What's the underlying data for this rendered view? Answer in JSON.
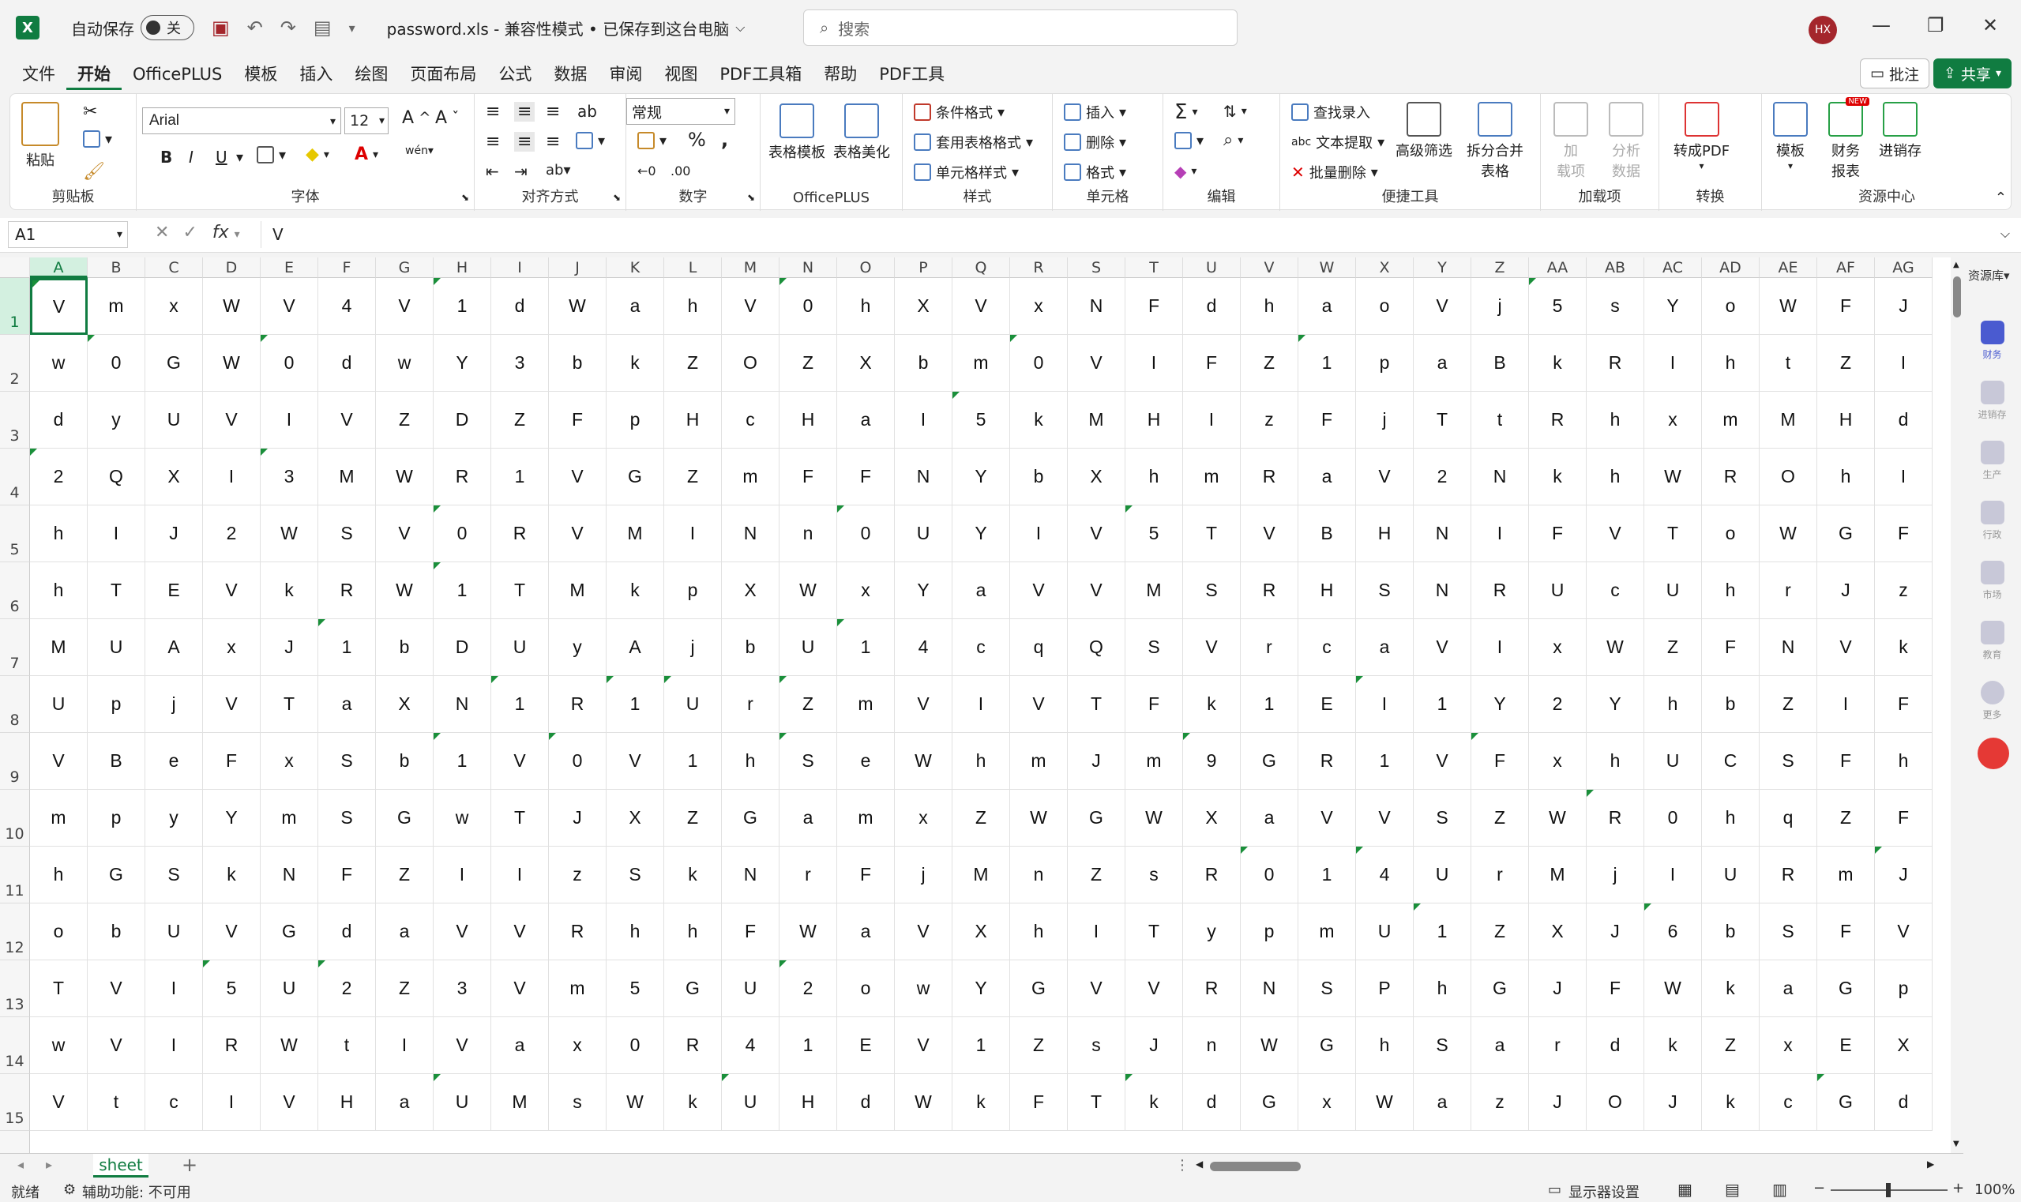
{
  "title_bar": {
    "autosave_label": "自动保存",
    "autosave_state": "关",
    "doc_title": "password.xls  -  兼容性模式 • 已保存到这台电脑",
    "search_placeholder": "搜索",
    "avatar_initials": "HX"
  },
  "menu": {
    "tabs": [
      "文件",
      "开始",
      "OfficePLUS",
      "模板",
      "插入",
      "绘图",
      "页面布局",
      "公式",
      "数据",
      "审阅",
      "视图",
      "PDF工具箱",
      "帮助",
      "PDF工具"
    ],
    "active": "开始",
    "comment_button": "批注",
    "share_button": "共享"
  },
  "ribbon": {
    "clipboard": {
      "paste": "粘贴",
      "label": "剪贴板"
    },
    "font": {
      "name": "Arial",
      "size": "12",
      "label": "字体",
      "bold": "B",
      "italic": "I",
      "underline": "U"
    },
    "alignment": {
      "label": "对齐方式"
    },
    "number": {
      "format": "常规",
      "label": "数字",
      "percent": "%"
    },
    "officeplus": {
      "table_template": "表格模板",
      "table_beautify": "表格美化",
      "label": "OfficePLUS"
    },
    "styles": {
      "conditional": "条件格式",
      "table_style": "套用表格格式",
      "cell_style": "单元格样式",
      "label": "样式"
    },
    "cells": {
      "insert": "插入",
      "delete": "删除",
      "format": "格式",
      "label": "单元格"
    },
    "editing": {
      "label": "编辑"
    },
    "tools": {
      "find_entry": "查找录入",
      "text_extract": "文本提取",
      "batch_delete": "批量删除",
      "advanced_filter": "高级筛选",
      "split_merge": "拆分合并\n表格",
      "label": "便捷工具"
    },
    "addins": {
      "addin": "加\n载项",
      "label": "加载项",
      "analyze": "分析\n数据"
    },
    "convert": {
      "to_pdf": "转成PDF",
      "label": "转换"
    },
    "resources": {
      "template": "模板",
      "finance": "财务\n报表",
      "inventory": "进销存",
      "label": "资源中心",
      "new_badge": "NEW"
    }
  },
  "formula_bar": {
    "name_box": "A1",
    "fx": "fx",
    "value": "V"
  },
  "grid": {
    "columns": [
      "A",
      "B",
      "C",
      "D",
      "E",
      "F",
      "G",
      "H",
      "I",
      "J",
      "K",
      "L",
      "M",
      "N",
      "O",
      "P",
      "Q",
      "R",
      "S",
      "T",
      "U",
      "V",
      "W",
      "X",
      "Y",
      "Z",
      "AA",
      "AB",
      "AC",
      "AD",
      "AE",
      "AF",
      "AG"
    ],
    "rows": [
      [
        "V",
        "m",
        "x",
        "W",
        "V",
        "4",
        "V",
        "1",
        "d",
        "W",
        "a",
        "h",
        "V",
        "0",
        "h",
        "X",
        "V",
        "x",
        "N",
        "F",
        "d",
        "h",
        "a",
        "o",
        "V",
        "j",
        "5",
        "s",
        "Y",
        "o",
        "W",
        "F",
        "J"
      ],
      [
        "w",
        "0",
        "G",
        "W",
        "0",
        "d",
        "w",
        "Y",
        "3",
        "b",
        "k",
        "Z",
        "O",
        "Z",
        "X",
        "b",
        "m",
        "0",
        "V",
        "I",
        "F",
        "Z",
        "1",
        "p",
        "a",
        "B",
        "k",
        "R",
        "I",
        "h",
        "t",
        "Z",
        "I"
      ],
      [
        "d",
        "y",
        "U",
        "V",
        "I",
        "V",
        "Z",
        "D",
        "Z",
        "F",
        "p",
        "H",
        "c",
        "H",
        "a",
        "I",
        "5",
        "k",
        "M",
        "H",
        "I",
        "z",
        "F",
        "j",
        "T",
        "t",
        "R",
        "h",
        "x",
        "m",
        "M",
        "H",
        "d"
      ],
      [
        "2",
        "Q",
        "X",
        "I",
        "3",
        "M",
        "W",
        "R",
        "1",
        "V",
        "G",
        "Z",
        "m",
        "F",
        "F",
        "N",
        "Y",
        "b",
        "X",
        "h",
        "m",
        "R",
        "a",
        "V",
        "2",
        "N",
        "k",
        "h",
        "W",
        "R",
        "O",
        "h",
        "I"
      ],
      [
        "h",
        "I",
        "J",
        "2",
        "W",
        "S",
        "V",
        "0",
        "R",
        "V",
        "M",
        "I",
        "N",
        "n",
        "0",
        "U",
        "Y",
        "I",
        "V",
        "5",
        "T",
        "V",
        "B",
        "H",
        "N",
        "I",
        "F",
        "V",
        "T",
        "o",
        "W",
        "G",
        "F"
      ],
      [
        "h",
        "T",
        "E",
        "V",
        "k",
        "R",
        "W",
        "1",
        "T",
        "M",
        "k",
        "p",
        "X",
        "W",
        "x",
        "Y",
        "a",
        "V",
        "V",
        "M",
        "S",
        "R",
        "H",
        "S",
        "N",
        "R",
        "U",
        "c",
        "U",
        "h",
        "r",
        "J",
        "z"
      ],
      [
        "M",
        "U",
        "A",
        "x",
        "J",
        "1",
        "b",
        "D",
        "U",
        "y",
        "A",
        "j",
        "b",
        "U",
        "1",
        "4",
        "c",
        "q",
        "Q",
        "S",
        "V",
        "r",
        "c",
        "a",
        "V",
        "I",
        "x",
        "W",
        "Z",
        "F",
        "N",
        "V",
        "k"
      ],
      [
        "U",
        "p",
        "j",
        "V",
        "T",
        "a",
        "X",
        "N",
        "1",
        "R",
        "1",
        "U",
        "r",
        "Z",
        "m",
        "V",
        "I",
        "V",
        "T",
        "F",
        "k",
        "1",
        "E",
        "I",
        "1",
        "Y",
        "2",
        "Y",
        "h",
        "b",
        "Z",
        "I",
        "F"
      ],
      [
        "V",
        "B",
        "e",
        "F",
        "x",
        "S",
        "b",
        "1",
        "V",
        "0",
        "V",
        "1",
        "h",
        "S",
        "e",
        "W",
        "h",
        "m",
        "J",
        "m",
        "9",
        "G",
        "R",
        "1",
        "V",
        "F",
        "x",
        "h",
        "U",
        "C",
        "S",
        "F",
        "h"
      ],
      [
        "m",
        "p",
        "y",
        "Y",
        "m",
        "S",
        "G",
        "w",
        "T",
        "J",
        "X",
        "Z",
        "G",
        "a",
        "m",
        "x",
        "Z",
        "W",
        "G",
        "W",
        "X",
        "a",
        "V",
        "V",
        "S",
        "Z",
        "W",
        "R",
        "0",
        "h",
        "q",
        "Z",
        "F"
      ],
      [
        "h",
        "G",
        "S",
        "k",
        "N",
        "F",
        "Z",
        "I",
        "I",
        "z",
        "S",
        "k",
        "N",
        "r",
        "F",
        "j",
        "M",
        "n",
        "Z",
        "s",
        "R",
        "0",
        "1",
        "4",
        "U",
        "r",
        "M",
        "j",
        "I",
        "U",
        "R",
        "m",
        "J"
      ],
      [
        "o",
        "b",
        "U",
        "V",
        "G",
        "d",
        "a",
        "V",
        "V",
        "R",
        "h",
        "h",
        "F",
        "W",
        "a",
        "V",
        "X",
        "h",
        "I",
        "T",
        "y",
        "p",
        "m",
        "U",
        "1",
        "Z",
        "X",
        "J",
        "6",
        "b",
        "S",
        "F",
        "V"
      ],
      [
        "T",
        "V",
        "I",
        "5",
        "U",
        "2",
        "Z",
        "3",
        "V",
        "m",
        "5",
        "G",
        "U",
        "2",
        "o",
        "w",
        "Y",
        "G",
        "V",
        "V",
        "R",
        "N",
        "S",
        "P",
        "h",
        "G",
        "J",
        "F",
        "W",
        "k",
        "a",
        "G",
        "p"
      ],
      [
        "w",
        "V",
        "I",
        "R",
        "W",
        "t",
        "I",
        "V",
        "a",
        "x",
        "0",
        "R",
        "4",
        "1",
        "E",
        "V",
        "1",
        "Z",
        "s",
        "J",
        "n",
        "W",
        "G",
        "h",
        "S",
        "a",
        "r",
        "d",
        "k",
        "Z",
        "x",
        "E",
        "X"
      ],
      [
        "V",
        "t",
        "c",
        "I",
        "V",
        "H",
        "a",
        "U",
        "M",
        "s",
        "W",
        "k",
        "U",
        "H",
        "d",
        "W",
        "k",
        "F",
        "T",
        "k",
        "d",
        "G",
        "x",
        "W",
        "a",
        "z",
        "J",
        "O",
        "J",
        "k",
        "c",
        "G",
        "d"
      ]
    ],
    "row_numbers": [
      "1",
      "2",
      "3",
      "4",
      "5",
      "6",
      "7",
      "8",
      "9",
      "10",
      "11",
      "12",
      "13",
      "14",
      "15"
    ]
  },
  "side_panel": {
    "title": "资源库",
    "items": [
      "财务",
      "进销存",
      "生产",
      "行政",
      "市场",
      "教育",
      "更多"
    ]
  },
  "sheet_bar": {
    "tab": "sheet",
    "add": "+"
  },
  "status_bar": {
    "ready": "就绪",
    "accessibility": "辅助功能: 不可用",
    "display_settings": "显示器设置",
    "zoom": "100%"
  }
}
